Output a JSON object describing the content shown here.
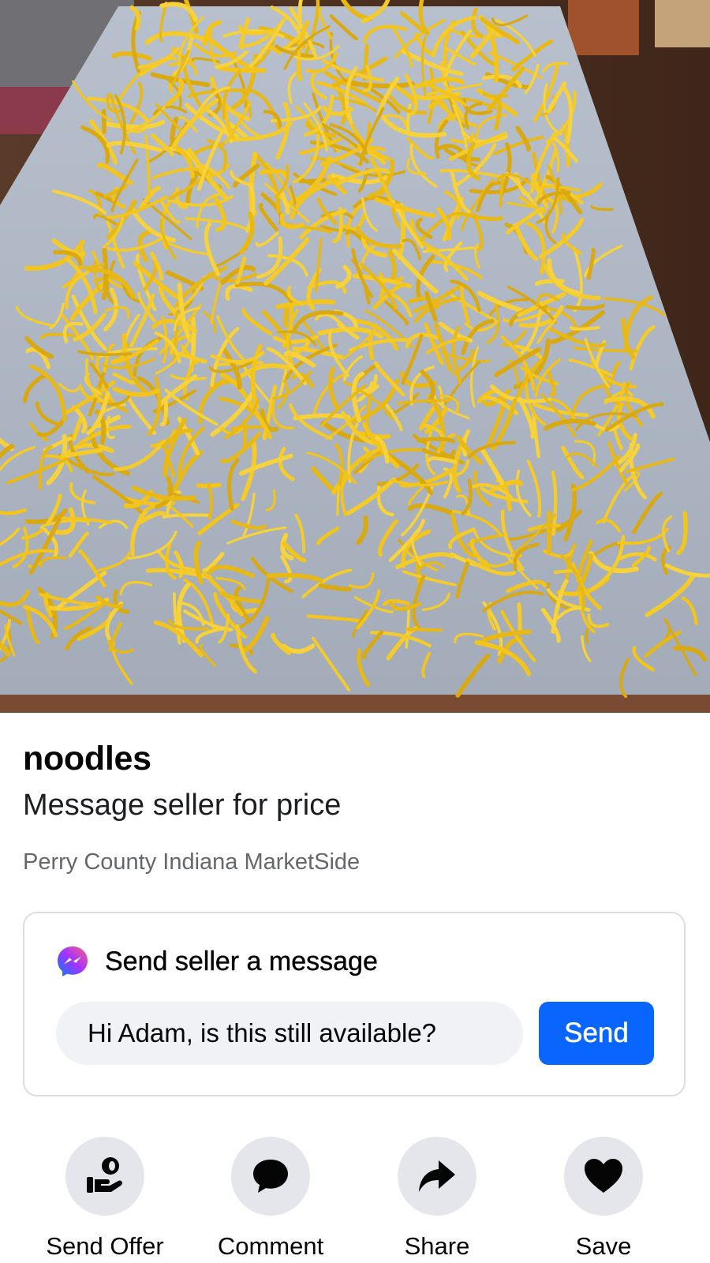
{
  "listing": {
    "title": "noodles",
    "price_text": "Message seller for price",
    "location": "Perry County Indiana MarketSide",
    "photo": "homemade-egg-noodles-drying-on-cloth"
  },
  "message_card": {
    "icon": "messenger-icon",
    "header": "Send seller a message",
    "input_value": "Hi Adam, is this still available?",
    "send_label": "Send",
    "send_color": "#0866ff"
  },
  "actions": [
    {
      "label": "Send Offer",
      "icon": "send-offer-icon"
    },
    {
      "label": "Comment",
      "icon": "comment-icon"
    },
    {
      "label": "Share",
      "icon": "share-icon"
    },
    {
      "label": "Save",
      "icon": "heart-icon"
    }
  ]
}
